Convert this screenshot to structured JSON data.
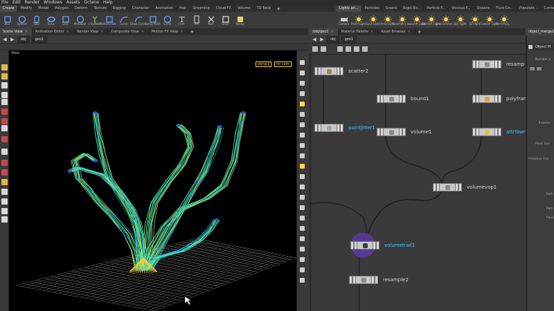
{
  "menu": [
    "File",
    "Edit",
    "Render",
    "Windows",
    "Assets",
    "Octane",
    "Help"
  ],
  "shelf_tabs_left": [
    "Create",
    "Modify",
    "Model",
    "Polygon",
    "Deform",
    "Texture",
    "Rigging",
    "Character",
    "Animation",
    "Hair",
    "Grooming",
    "Cloud FX",
    "Volume",
    "TD Tools"
  ],
  "shelf_tabs_right": [
    "Lights an...",
    "Particles",
    "Grains",
    "Rigid Bo...",
    "Particle F...",
    "Viscous F...",
    "Oceans",
    "Fluid Co...",
    "Populate...",
    "Container",
    "Pyro FX"
  ],
  "shelf_tools_left": [
    {
      "label": "Box",
      "icon": "box-icon",
      "color": "#6fa8ff"
    },
    {
      "label": "Sphere",
      "icon": "sphere-icon",
      "color": "#6fa8ff"
    },
    {
      "label": "Tube",
      "icon": "tube-icon",
      "color": "#6fa8ff"
    },
    {
      "label": "Torus",
      "icon": "torus-icon",
      "color": "#6fa8ff"
    },
    {
      "label": "Grid",
      "icon": "grid-icon",
      "color": "#6fa8ff"
    },
    {
      "label": "Metaball",
      "icon": "metaball-icon",
      "color": "#6fa8ff"
    },
    {
      "label": "L-System",
      "icon": "lsystem-icon",
      "color": "#8fd06a"
    },
    {
      "label": "Platonic Sol...",
      "icon": "platonic-icon",
      "color": "#6fa8ff"
    },
    {
      "label": "Curve",
      "icon": "curve-icon",
      "color": "#6fa8ff"
    },
    {
      "label": "Draw Curve",
      "icon": "draw-curve-icon",
      "color": "#6fa8ff"
    },
    {
      "label": "Spray Paint",
      "icon": "spray-paint-icon",
      "color": "#6fa8ff"
    },
    {
      "label": "Circle",
      "icon": "circle-icon",
      "color": "#6fa8ff"
    },
    {
      "label": "Font",
      "icon": "font-icon",
      "color": "#e0e0e0"
    },
    {
      "label": "File",
      "icon": "file-icon",
      "color": "#e0e0e0"
    },
    {
      "label": "Null",
      "icon": "null-icon",
      "color": "#e0e0e0"
    },
    {
      "label": "Rivet",
      "icon": "rivet-icon",
      "color": "#e0e0e0"
    },
    {
      "label": "Sticky",
      "icon": "sticky-icon",
      "color": "#e0e0e0"
    }
  ],
  "shelf_tools_right": [
    {
      "label": "Camera",
      "icon": "camera-icon",
      "color": "#d0d0d0"
    },
    {
      "label": "Point Light",
      "icon": "point-light-icon",
      "color": "#ffd45a"
    },
    {
      "label": "Spot Light",
      "icon": "spot-light-icon",
      "color": "#ffd45a"
    },
    {
      "label": "Area Light",
      "icon": "area-light-icon",
      "color": "#ffd45a"
    },
    {
      "label": "Geometry L...",
      "icon": "geometry-light-icon",
      "color": "#ffd45a"
    },
    {
      "label": "Volume Light",
      "icon": "volume-light-icon",
      "color": "#ffd45a"
    },
    {
      "label": "Distant Light",
      "icon": "distant-light-icon",
      "color": "#ffd45a"
    },
    {
      "label": "Environmen...",
      "icon": "environment-light-icon",
      "color": "#ffd45a"
    },
    {
      "label": "Sky Light",
      "icon": "sky-light-icon",
      "color": "#ffd45a"
    },
    {
      "label": "GI Light",
      "icon": "gi-light-icon",
      "color": "#ffd45a"
    },
    {
      "label": "Caustic Light",
      "icon": "caustic-light-icon",
      "color": "#ffd45a"
    },
    {
      "label": "Portal Lig...",
      "icon": "portal-light-icon",
      "color": "#ffd45a"
    }
  ],
  "pane_tabs_left": [
    "Scene View",
    "Animation Editor",
    "Render View",
    "Composite View",
    "Motion FX View"
  ],
  "pane_tabs_right": [
    "/obj/geo1",
    "Material Palette",
    "Asset Browser"
  ],
  "pane_tab_params": "object_merge1",
  "viewport_path": {
    "context": "obj",
    "node": "geo1"
  },
  "network_path": {
    "context": "obj",
    "node": "geo1"
  },
  "viewport": {
    "title": "View",
    "camera_menu": "persp1",
    "cam_menu": "no cam"
  },
  "network": {
    "nodes": [
      {
        "name": "scatter2",
        "icon_color": "#9a8a60"
      },
      {
        "name": "pointjitter1",
        "icon_color": "#9aa8b0",
        "label_color": "cyan"
      },
      {
        "name": "bound1",
        "icon_color": "#8a8a8a"
      },
      {
        "name": "volume1",
        "icon_color": "#8a8a8a"
      },
      {
        "name": "volumevop1",
        "icon_color": "#8a8a8a"
      },
      {
        "name": "volumetrail1",
        "icon_color": "#3a3a40",
        "label_color": "cyan"
      },
      {
        "name": "resample2",
        "icon_color": "#8a8a8a"
      },
      {
        "name": "resamp",
        "icon_color": "#8a8a8a"
      },
      {
        "name": "polyfran",
        "icon_color": "#e0a030"
      },
      {
        "name": "attribwr",
        "icon_color": "#e0c040",
        "label_color": "cyan"
      }
    ]
  },
  "params": {
    "header": "Object M",
    "labels": [
      "Number o",
      "Transfor",
      "Point Gro",
      "Primitive Gro",
      "Path",
      "Path",
      "Pack"
    ]
  },
  "colors": {
    "accent_cyan": "#43c8ff",
    "camera_yellow": "#ffd84a",
    "selection_purple": "#5a3aa0"
  }
}
